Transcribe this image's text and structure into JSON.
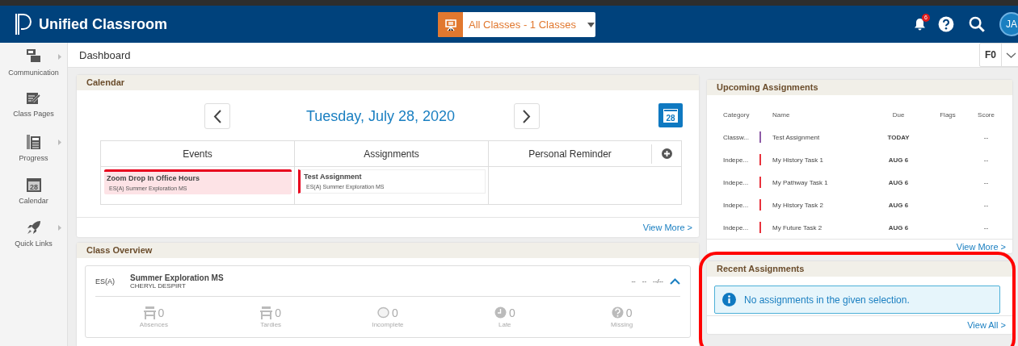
{
  "header": {
    "title": "Unified Classroom",
    "class_selector": {
      "value": "All Classes - 1 Classes"
    },
    "notification_count": "6",
    "avatar": "JA"
  },
  "sidebar": {
    "items": [
      {
        "label": "Communication",
        "has_submenu": true
      },
      {
        "label": "Class Pages",
        "has_submenu": false
      },
      {
        "label": "Progress",
        "has_submenu": true
      },
      {
        "label": "Calendar",
        "has_submenu": false,
        "icon_day": "28"
      },
      {
        "label": "Quick Links",
        "has_submenu": true
      }
    ]
  },
  "page": {
    "title": "Dashboard",
    "term_selector": {
      "value": "F0"
    }
  },
  "calendar": {
    "title": "Calendar",
    "date": "Tuesday, July 28, 2020",
    "icon_day": "28",
    "columns": [
      "Events",
      "Assignments",
      "Personal Reminder"
    ],
    "events": [
      {
        "title": "Zoom Drop In Office Hours",
        "subtitle": "ES(A) Summer Exploration MS"
      }
    ],
    "assignments": [
      {
        "title": "Test Assignment",
        "subtitle": "ES(A) Summer Exploration MS"
      }
    ],
    "view_more": "View More >"
  },
  "class_overview": {
    "title": "Class Overview",
    "classes": [
      {
        "code": "ES(A)",
        "name": "Summer Exploration MS",
        "teacher": "CHERYL DESPIRT",
        "grade": [
          "--",
          "--",
          "--/--"
        ],
        "expanded": true,
        "stats": [
          {
            "value": "0",
            "label": "Absences"
          },
          {
            "value": "0",
            "label": "Tardies"
          },
          {
            "value": "0",
            "label": "Incomplete"
          },
          {
            "value": "0",
            "label": "Late"
          },
          {
            "value": "0",
            "label": "Missing"
          }
        ]
      }
    ]
  },
  "upcoming_assignments": {
    "title": "Upcoming Assignments",
    "columns": [
      "Category",
      "Name",
      "Due",
      "Flags",
      "Score"
    ],
    "rows": [
      {
        "category": "Classw...",
        "color": "#8e5ba6",
        "name": "Test Assignment",
        "due": "TODAY",
        "score": "--"
      },
      {
        "category": "Indepe...",
        "color": "#e8323c",
        "name": "My History Task 1",
        "due": "AUG 6",
        "score": "--"
      },
      {
        "category": "Indepe...",
        "color": "#e8323c",
        "name": "My Pathway Task 1",
        "due": "AUG 6",
        "score": "--"
      },
      {
        "category": "Indepe...",
        "color": "#e8323c",
        "name": "My History Task 2",
        "due": "AUG 6",
        "score": "--"
      },
      {
        "category": "Indepe...",
        "color": "#e8323c",
        "name": "My Future Task 2",
        "due": "AUG 6",
        "score": "--"
      }
    ],
    "view_more": "View More >"
  },
  "recent_assignments": {
    "title": "Recent Assignments",
    "message": "No assignments in the given selection.",
    "view_all": "View All >",
    "highlighted": true
  }
}
